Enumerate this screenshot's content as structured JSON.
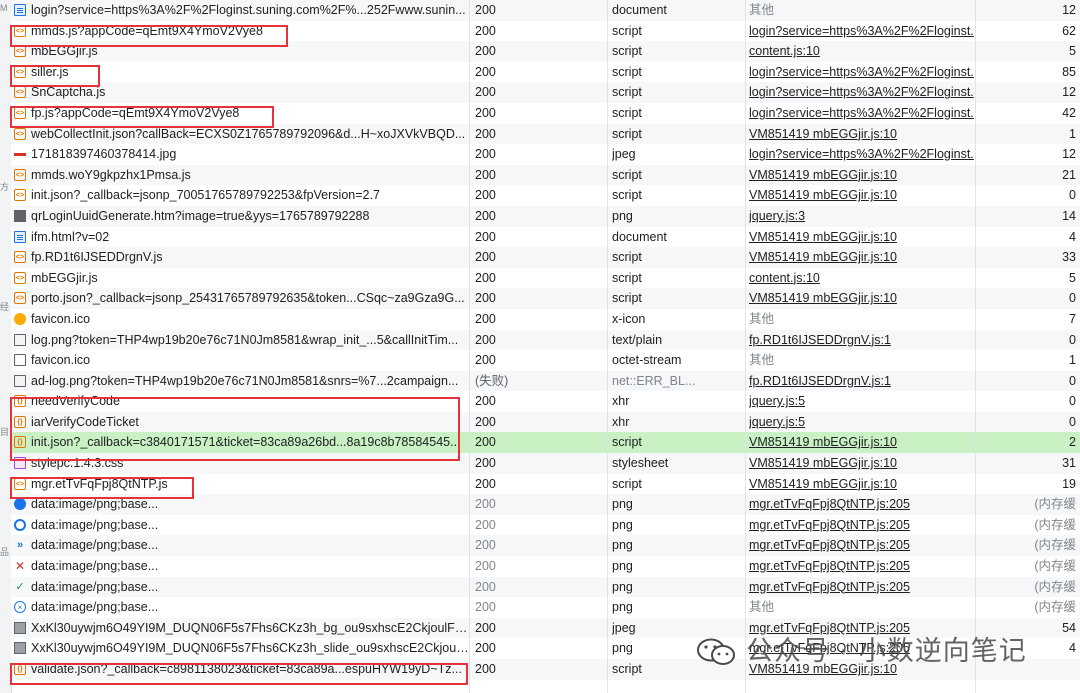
{
  "rows": [
    {
      "name": "login?service=https%3A%2F%2Floginst.suning.com%2F%...252Fwww.sunin...",
      "status": "200",
      "type": "document",
      "initiator": "其他",
      "initiator_link": false,
      "size": "12",
      "icon": "document-icon"
    },
    {
      "name": "mmds.js?appCode=qEmt9X4YmoV2Vye8",
      "status": "200",
      "type": "script",
      "initiator": "login?service=https%3A%2F%2Floginst.",
      "initiator_link": true,
      "size": "62",
      "icon": "script-icon"
    },
    {
      "name": "mbEGGjir.js",
      "status": "200",
      "type": "script",
      "initiator": "content.js:10",
      "initiator_link": true,
      "size": "5",
      "icon": "script-icon"
    },
    {
      "name": "siller.js",
      "status": "200",
      "type": "script",
      "initiator": "login?service=https%3A%2F%2Floginst.",
      "initiator_link": true,
      "size": "85",
      "icon": "script-icon"
    },
    {
      "name": "SnCaptcha.js",
      "status": "200",
      "type": "script",
      "initiator": "login?service=https%3A%2F%2Floginst.",
      "initiator_link": true,
      "size": "12",
      "icon": "script-icon"
    },
    {
      "name": "fp.js?appCode=qEmt9X4YmoV2Vye8",
      "status": "200",
      "type": "script",
      "initiator": "login?service=https%3A%2F%2Floginst.",
      "initiator_link": true,
      "size": "42",
      "icon": "script-icon"
    },
    {
      "name": "webCollectInit.json?callBack=ECXS0Z1765789792096&d...H~xoJXVkVBQD...",
      "status": "200",
      "type": "script",
      "initiator": "VM851419 mbEGGjir.js:10",
      "initiator_link": true,
      "size": "1",
      "icon": "script-icon"
    },
    {
      "name": "171818397460378414.jpg",
      "status": "200",
      "type": "jpeg",
      "initiator": "login?service=https%3A%2F%2Floginst.",
      "initiator_link": true,
      "size": "12",
      "icon": "image-line-icon"
    },
    {
      "name": "mmds.woY9gkpzhx1Pmsa.js",
      "status": "200",
      "type": "script",
      "initiator": "VM851419 mbEGGjir.js:10",
      "initiator_link": true,
      "size": "21",
      "icon": "script-icon"
    },
    {
      "name": "init.json?_callback=jsonp_70051765789792253&fpVersion=2.7",
      "status": "200",
      "type": "script",
      "initiator": "VM851419 mbEGGjir.js:10",
      "initiator_link": true,
      "size": "0",
      "icon": "script-icon"
    },
    {
      "name": "qrLoginUuidGenerate.htm?image=true&yys=1765789792288",
      "status": "200",
      "type": "png",
      "initiator": "jquery.js:3",
      "initiator_link": true,
      "size": "14",
      "icon": "qr-image-icon"
    },
    {
      "name": "ifm.html?v=02",
      "status": "200",
      "type": "document",
      "initiator": "VM851419 mbEGGjir.js:10",
      "initiator_link": true,
      "size": "4",
      "icon": "document-icon"
    },
    {
      "name": "fp.RD1t6IJSEDDrgnV.js",
      "status": "200",
      "type": "script",
      "initiator": "VM851419 mbEGGjir.js:10",
      "initiator_link": true,
      "size": "33",
      "icon": "script-icon"
    },
    {
      "name": "mbEGGjir.js",
      "status": "200",
      "type": "script",
      "initiator": "content.js:10",
      "initiator_link": true,
      "size": "5",
      "icon": "script-icon"
    },
    {
      "name": "porto.json?_callback=jsonp_25431765789792635&token...CSqc~za9Gza9G...",
      "status": "200",
      "type": "script",
      "initiator": "VM851419 mbEGGjir.js:10",
      "initiator_link": true,
      "size": "0",
      "icon": "script-icon"
    },
    {
      "name": "favicon.ico",
      "status": "200",
      "type": "x-icon",
      "initiator": "其他",
      "initiator_link": false,
      "size": "7",
      "icon": "favicon-icon"
    },
    {
      "name": "log.png?token=THP4wp19b20e76c71N0Jm8581&wrap_init_...5&callInitTim...",
      "status": "200",
      "type": "text/plain",
      "initiator": "fp.RD1t6IJSEDDrgnV.js:1",
      "initiator_link": true,
      "size": "0",
      "icon": "image-icon"
    },
    {
      "name": "favicon.ico",
      "status": "200",
      "type": "octet-stream",
      "initiator": "其他",
      "initiator_link": false,
      "size": "1",
      "icon": "blank-file-icon"
    },
    {
      "name": "ad-log.png?token=THP4wp19b20e76c71N0Jm8581&snrs=%7...2campaign...",
      "status": "(失败)",
      "type": "net::ERR_BL...",
      "initiator": "fp.RD1t6IJSEDDrgnV.js:1",
      "initiator_link": true,
      "size": "0",
      "icon": "image-icon",
      "failed": true
    },
    {
      "name": "needVerifyCode",
      "status": "200",
      "type": "xhr",
      "initiator": "jquery.js:5",
      "initiator_link": true,
      "size": "0",
      "icon": "xhr-icon"
    },
    {
      "name": "iarVerifyCodeTicket",
      "status": "200",
      "type": "xhr",
      "initiator": "jquery.js:5",
      "initiator_link": true,
      "size": "0",
      "icon": "xhr-icon"
    },
    {
      "name": "init.json?_callback=c3840171571&ticket=83ca89a26bd...8a19c8b78584545...",
      "status": "200",
      "type": "script",
      "initiator": "VM851419 mbEGGjir.js:10",
      "initiator_link": true,
      "size": "2",
      "icon": "xhr-icon",
      "highlighted": true
    },
    {
      "name": "stylepc.1.4.3.css",
      "status": "200",
      "type": "stylesheet",
      "initiator": "VM851419 mbEGGjir.js:10",
      "initiator_link": true,
      "size": "31",
      "icon": "stylesheet-icon"
    },
    {
      "name": "mgr.etTvFqFpj8QtNTP.js",
      "status": "200",
      "type": "script",
      "initiator": "VM851419 mbEGGjir.js:10",
      "initiator_link": true,
      "size": "19",
      "icon": "script-icon"
    },
    {
      "name": "data:image/png;base...",
      "status": "200",
      "type": "png",
      "initiator": "mgr.etTvFqFpj8QtNTP.js:205",
      "initiator_link": true,
      "size": "(内存缓",
      "icon": "blue-dot-icon",
      "cached": true
    },
    {
      "name": "data:image/png;base...",
      "status": "200",
      "type": "png",
      "initiator": "mgr.etTvFqFpj8QtNTP.js:205",
      "initiator_link": true,
      "size": "(内存缓",
      "icon": "refresh-ring-icon",
      "cached": true
    },
    {
      "name": "data:image/png;base...",
      "status": "200",
      "type": "png",
      "initiator": "mgr.etTvFqFpj8QtNTP.js:205",
      "initiator_link": true,
      "size": "(内存缓",
      "icon": "double-chevron-icon",
      "cached": true
    },
    {
      "name": "data:image/png;base...",
      "status": "200",
      "type": "png",
      "initiator": "mgr.etTvFqFpj8QtNTP.js:205",
      "initiator_link": true,
      "size": "(内存缓",
      "icon": "red-x-icon",
      "cached": true
    },
    {
      "name": "data:image/png;base...",
      "status": "200",
      "type": "png",
      "initiator": "mgr.etTvFqFpj8QtNTP.js:205",
      "initiator_link": true,
      "size": "(内存缓",
      "icon": "green-check-icon",
      "cached": true
    },
    {
      "name": "data:image/png;base...",
      "status": "200",
      "type": "png",
      "initiator": "其他",
      "initiator_link": false,
      "size": "(内存缓",
      "icon": "circle-cross-icon",
      "cached": true
    },
    {
      "name": "XxKl30uywjm6O49YI9M_DUQN06F5s7Fhs6CKz3h_bg_ou9sxhscE2CkjoulFs5....",
      "status": "200",
      "type": "jpeg",
      "initiator": "mgr.etTvFqFpj8QtNTP.js:205",
      "initiator_link": true,
      "size": "54",
      "icon": "thumbnail-icon"
    },
    {
      "name": "XxKl30uywjm6O49YI9M_DUQN06F5s7Fhs6CKz3h_slide_ou9sxhscE2CkjoulF...",
      "status": "200",
      "type": "png",
      "initiator": "mgr.etTvFqFpj8QtNTP.js:205",
      "initiator_link": true,
      "size": "4",
      "icon": "thumbnail-icon"
    },
    {
      "name": "validate.json?_callback=c8981138023&ticket=83ca89a...espuHYW19yD~Tz...",
      "status": "200",
      "type": "script",
      "initiator": "VM851419 mbEGGjir.js:10",
      "initiator_link": true,
      "size": "",
      "icon": "xhr-icon"
    }
  ],
  "highlight_boxes": [
    {
      "label": "mmds.js?appCode=qEmt9X4YmoV2Vye8"
    },
    {
      "label": "siller.js"
    },
    {
      "label": "fp.js?appCode=qEmt9X4YmoV2Vye8"
    },
    {
      "label": "needVerifyCode / iarVerifyCodeTicket / init.json"
    },
    {
      "label": "mgr.etTvFqFpj8QtNTP.js"
    },
    {
      "label": "validate.json"
    }
  ],
  "left_strip_glyphs": [
    "M",
    "方",
    "经",
    "目",
    "品"
  ],
  "watermark": {
    "text": "公众号 · 小数逆向笔记",
    "icon": "wechat-logo-icon"
  },
  "colors": {
    "highlight_row": "#c9f1c4",
    "annotation_box": "#e5323b",
    "script_icon": "#e37400"
  }
}
